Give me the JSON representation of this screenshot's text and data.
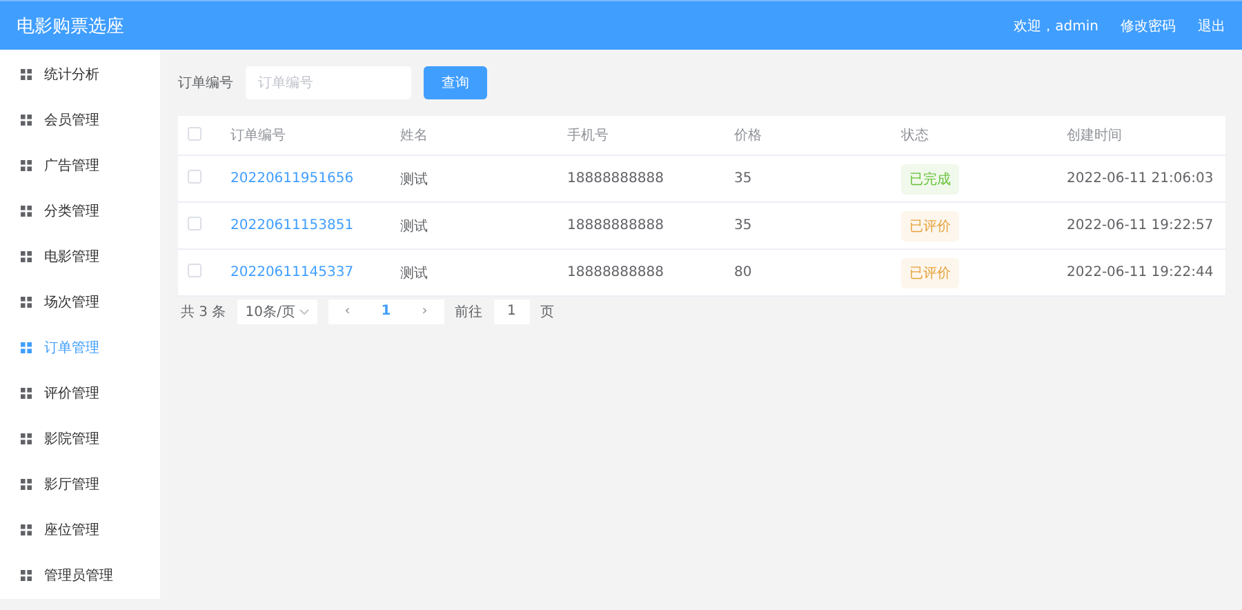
{
  "header": {
    "title": "电影购票选座",
    "welcome": "欢迎，admin",
    "links": [
      "修改密码",
      "退出"
    ]
  },
  "sidebar": {
    "items": [
      {
        "label": "统计分析",
        "selected": false
      },
      {
        "label": "会员管理",
        "selected": false
      },
      {
        "label": "广告管理",
        "selected": false
      },
      {
        "label": "分类管理",
        "selected": false
      },
      {
        "label": "电影管理",
        "selected": false
      },
      {
        "label": "场次管理",
        "selected": false
      },
      {
        "label": "订单管理",
        "selected": true
      },
      {
        "label": "评价管理",
        "selected": false
      },
      {
        "label": "影院管理",
        "selected": false
      },
      {
        "label": "影厅管理",
        "selected": false
      },
      {
        "label": "座位管理",
        "selected": false
      },
      {
        "label": "管理员管理",
        "selected": false
      }
    ]
  },
  "search": {
    "label": "订单编号",
    "placeholder": "订单编号",
    "button": "查询"
  },
  "table": {
    "select_all_checked": false,
    "columns": [
      "订单编号",
      "姓名",
      "手机号",
      "价格",
      "状态",
      "创建时间"
    ],
    "rows": [
      {
        "checked": false,
        "order_no": "20220611951656",
        "name": "测试",
        "phone": "18888888888",
        "price": "35",
        "status": {
          "text": "已完成",
          "kind": "success"
        },
        "created": "2022-06-11 21:06:03"
      },
      {
        "checked": false,
        "order_no": "20220611153851",
        "name": "测试",
        "phone": "18888888888",
        "price": "35",
        "status": {
          "text": "已评价",
          "kind": "warning"
        },
        "created": "2022-06-11 19:22:57"
      },
      {
        "checked": false,
        "order_no": "20220611145337",
        "name": "测试",
        "phone": "18888888888",
        "price": "80",
        "status": {
          "text": "已评价",
          "kind": "warning"
        },
        "created": "2022-06-11 19:22:44"
      }
    ]
  },
  "pagination": {
    "total": "共 3 条",
    "page_size": "10条/页",
    "prev": "‹",
    "pages": [
      {
        "label": "1",
        "selected": true
      }
    ],
    "next": "›",
    "goto_label": "前往",
    "goto_value": "1",
    "goto_suffix": "页"
  }
}
